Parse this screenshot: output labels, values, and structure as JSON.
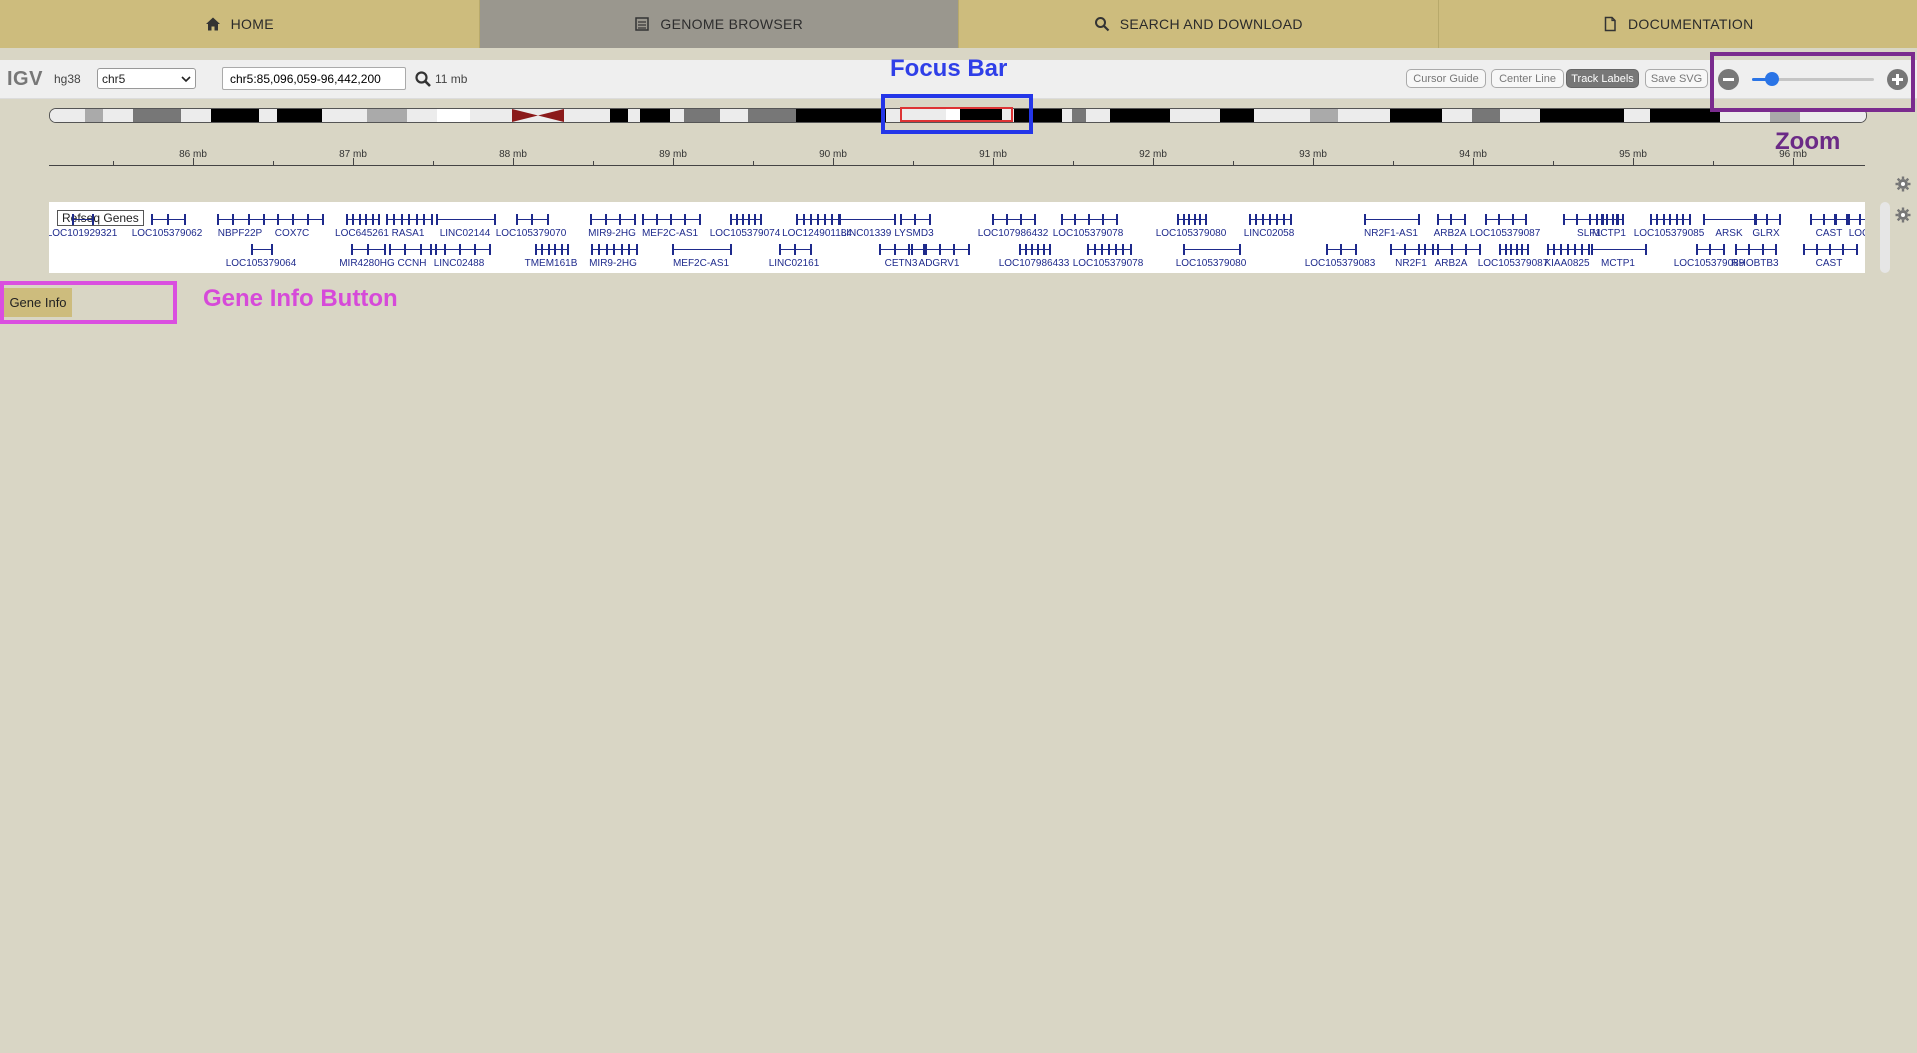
{
  "nav": {
    "tabs": [
      {
        "label": "HOME",
        "icon": "home-icon"
      },
      {
        "label": "GENOME BROWSER",
        "icon": "browser-icon",
        "active": true
      },
      {
        "label": "SEARCH AND DOWNLOAD",
        "icon": "search-icon"
      },
      {
        "label": "DOCUMENTATION",
        "icon": "document-icon"
      }
    ]
  },
  "igv": {
    "logo": "IGV",
    "genome": "hg38",
    "chromosome": "chr5",
    "locus": "chr5:85,096,059-96,442,200",
    "window_size": "11 mb",
    "buttons": {
      "cursor_guide": "Cursor Guide",
      "center_line": "Center Line",
      "track_labels": "Track Labels",
      "save_svg": "Save SVG"
    },
    "zoom_level": 0.16
  },
  "ruler": {
    "ticks": [
      "86 mb",
      "87 mb",
      "88 mb",
      "89 mb",
      "90 mb",
      "91 mb",
      "92 mb",
      "93 mb",
      "94 mb",
      "95 mb",
      "96 mb"
    ]
  },
  "track": {
    "name": "Refseq Genes",
    "row1": [
      "LOC101929321",
      "LOC105379062",
      "NBPF22P",
      "COX7C",
      "LOC645261",
      "RASA1",
      "LINC02144",
      "LOC105379070",
      "MIR9-2HG",
      "MEF2C-AS1",
      "LOC105379074",
      "LOC124901184",
      "LINC01339",
      "LYSMD3",
      "LOC107986432",
      "LOC105379078",
      "LOC105379080",
      "LINC02058",
      "NR2F1-AS1",
      "ARB2A",
      "LOC105379087",
      "SLF1",
      "MCTP1",
      "LOC105379085",
      "ARSK",
      "GLRX",
      "CAST",
      "LOC"
    ],
    "row2": [
      "LOC105379064",
      "MIR4280HG",
      "CCNH",
      "LINC02488",
      "TMEM161B",
      "MIR9-2HG",
      "MEF2C-AS1",
      "LINC02161",
      "CETN3",
      "ADGRV1",
      "LOC107986433",
      "LOC105379078",
      "LOC105379080",
      "LOC105379083",
      "NR2F1",
      "ARB2A",
      "LOC105379087",
      "KIAA0825",
      "MCTP1",
      "LOC105379089",
      "RHOBTB3",
      "CAST"
    ]
  },
  "gene_info": {
    "label": "Gene Info"
  },
  "annotations": {
    "focus_bar": "Focus Bar",
    "zoom": "Zoom",
    "gene_info_button": "Gene Info Button"
  },
  "colors": {
    "nav_bg": "#cdbc7d",
    "gene": "#1e2a8c",
    "focus": "#2f3fe8",
    "zoom": "#6b2a86",
    "gene_info": "#d64ad9"
  }
}
